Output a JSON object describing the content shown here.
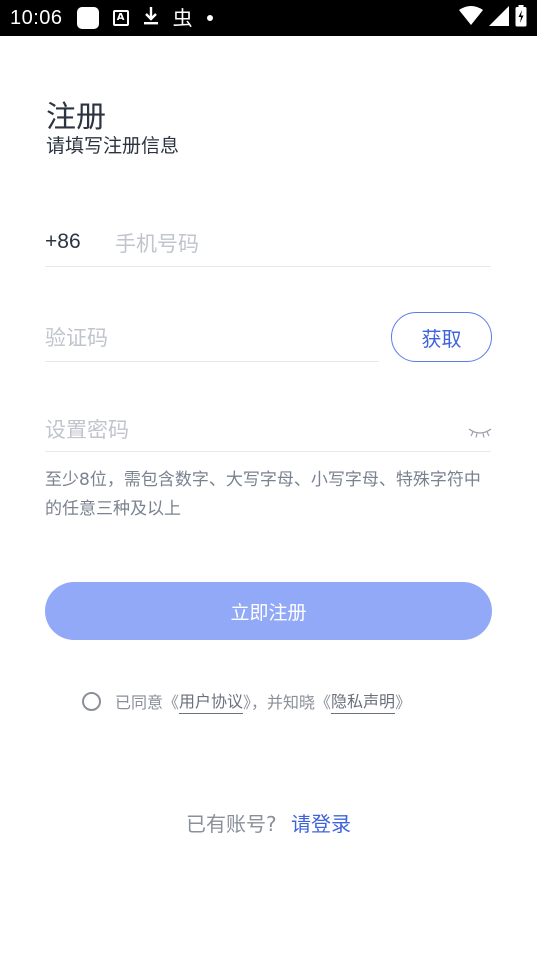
{
  "status_bar": {
    "time": "10:06",
    "icons": [
      "notification-square-icon",
      "a-letter-icon",
      "download-icon",
      "bug-icon",
      "dot-icon",
      "wifi-icon",
      "signal-icon",
      "battery-icon"
    ],
    "bug_glyph": "虫"
  },
  "header": {
    "title": "注册",
    "subtitle": "请填写注册信息"
  },
  "phone": {
    "country_code": "+86",
    "placeholder": "手机号码"
  },
  "verification": {
    "placeholder": "验证码",
    "get_code_label": "获取"
  },
  "password": {
    "placeholder": "设置密码",
    "hint": "至少8位，需包含数字、大写字母、小写字母、特殊字符中的任意三种及以上",
    "visibility_icon": "eye-closed-icon"
  },
  "submit": {
    "label": "立即注册"
  },
  "agreement": {
    "prefix": "已同意《",
    "user_agreement": "用户协议",
    "middle": "》，并知晓《",
    "privacy": "隐私声明",
    "suffix": "》"
  },
  "login": {
    "prompt": "已有账号?",
    "link": "请登录"
  },
  "colors": {
    "accent": "#3f63dd",
    "submit_disabled": "#92a9f7",
    "placeholder": "#c0c4cc",
    "status_bar": "#000000"
  }
}
